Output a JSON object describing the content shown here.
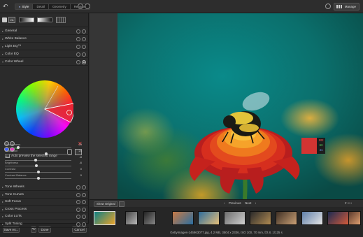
{
  "toolbar": {
    "tabs": [
      {
        "label": "Style",
        "active": true
      },
      {
        "label": "Detail",
        "active": false
      },
      {
        "label": "Geometry",
        "active": false
      },
      {
        "label": "Rename",
        "active": false
      }
    ],
    "manage_label": "Manage"
  },
  "panel": {
    "tool_badge": "2A",
    "sections_top": [
      "General",
      "White Balance",
      "Light EQ™",
      "Color EQ",
      "Color Wheel"
    ],
    "auto_preview_label": "Auto preview the selected range",
    "sliders": [
      {
        "label": "Smoothness",
        "value": "20",
        "fraction": 0.2
      },
      {
        "label": "Saturation",
        "value": "24",
        "fraction": 0.62
      },
      {
        "label": "Hue",
        "value": "-8",
        "fraction": 0.46
      },
      {
        "label": "Brightness",
        "value": "-6",
        "fraction": 0.47
      },
      {
        "label": "Contrast",
        "value": "0",
        "fraction": 0.5
      },
      {
        "label": "Contrast Balance",
        "value": "0",
        "fraction": 0.5
      }
    ],
    "sections_bottom": [
      "Tone Wheels",
      "Tone Curves",
      "Soft Focus",
      "Cross Process",
      "Color LUTs",
      "Split Toning"
    ],
    "footer": {
      "save_as": "Save As...",
      "done": "Done",
      "cancel": "Cancel"
    }
  },
  "viewer": {
    "rgb": {
      "r": "102",
      "g": "63",
      "b": "41",
      "swatch_color": "#d23432"
    }
  },
  "filmstrip": {
    "show_original": "Show Original",
    "previous": "Previous",
    "next": "Next",
    "status": "GettyImages-146963077.jpg, 4.2 MB, 3504 x 2336, ISO 100, 70 mm, f/2.8, 1/125 s"
  },
  "colors": {
    "accent": "#9ad",
    "delete": "#e04040"
  }
}
